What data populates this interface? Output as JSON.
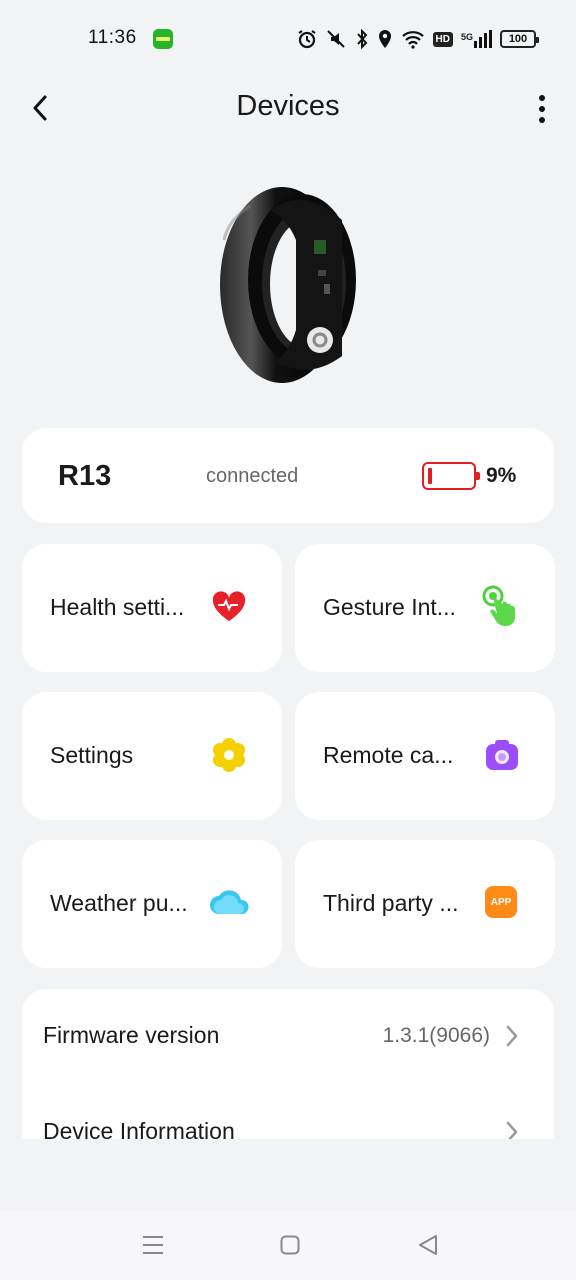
{
  "status_bar": {
    "time": "11:36",
    "network_type": "5G",
    "hd_label": "HD",
    "battery_level": "100",
    "icons": [
      "alarm-icon",
      "mute-icon",
      "bluetooth-icon",
      "location-icon",
      "wifi-icon",
      "hd-icon",
      "signal-icon",
      "battery-icon"
    ]
  },
  "header": {
    "title": "Devices",
    "back_icon": "chevron-left-icon",
    "menu_icon": "more-vertical-icon"
  },
  "device": {
    "name": "R13",
    "status": "connected",
    "battery_percent": "9%",
    "battery_level": 0.09,
    "battery_color": "#e02020"
  },
  "tiles": [
    {
      "label": "Health setti...",
      "icon": "heart-icon",
      "color": "#e8202a"
    },
    {
      "label": "Gesture Int...",
      "icon": "gesture-icon",
      "color": "#4cd43c"
    },
    {
      "label": "Settings",
      "icon": "gear-icon",
      "color": "#f4d000"
    },
    {
      "label": "Remote ca...",
      "icon": "camera-icon",
      "color": "#9b4dfa"
    },
    {
      "label": "Weather pu...",
      "icon": "cloud-icon",
      "color": "#38c6f2"
    },
    {
      "label": "Third party ...",
      "icon": "app-icon",
      "color": "#ff8a18",
      "icon_text": "APP"
    }
  ],
  "list": [
    {
      "label": "Firmware version",
      "value": "1.3.1(9066)"
    },
    {
      "label": "Device Information",
      "value": ""
    }
  ],
  "nav": {
    "icons": [
      "menu-icon",
      "home-icon",
      "back-icon"
    ]
  }
}
